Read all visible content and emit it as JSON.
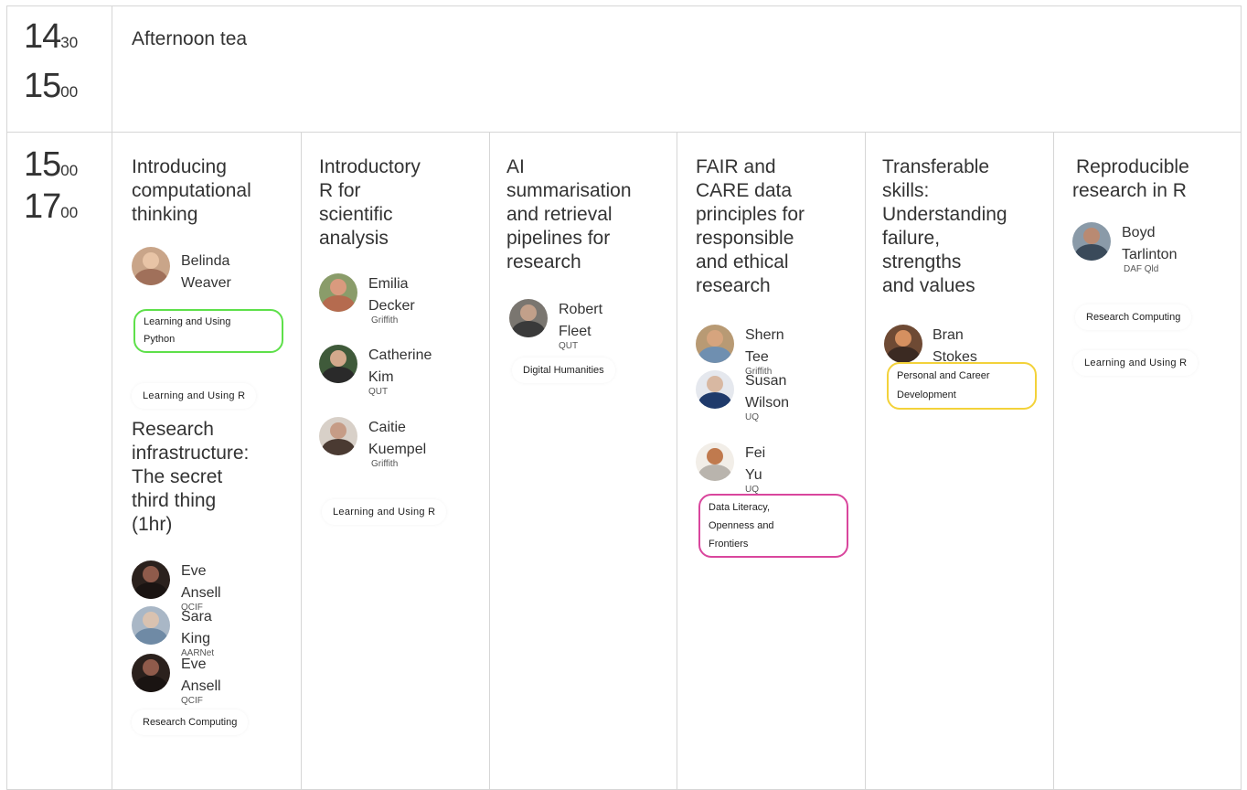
{
  "rows": [
    {
      "start": {
        "h": "14",
        "m": "30"
      },
      "end": {
        "h": "15",
        "m": "00"
      },
      "title": "Afternoon tea"
    },
    {
      "start": {
        "h": "15",
        "m": "00"
      },
      "end": {
        "h": "17",
        "m": "00"
      },
      "sessions": [
        {
          "title_lines": [
            "Introducing",
            "computational",
            "thinking"
          ],
          "speakers": [
            {
              "name_lines": [
                "Belinda",
                "Weaver"
              ],
              "org": ""
            }
          ],
          "tags": [
            {
              "lines": [
                "Learning and Using",
                "Python"
              ],
              "color": "#5ee04a"
            },
            {
              "lines": [
                "Learning and Using R"
              ],
              "color": ""
            }
          ],
          "second_title_lines": [
            "Research",
            "infrastructure:",
            "The secret",
            "third thing",
            "(1hr)"
          ],
          "second_speakers": [
            {
              "name_lines": [
                "Eve Ansell"
              ],
              "org": "QCIF"
            },
            {
              "name_lines": [
                "Sara King"
              ],
              "org": "AARNet"
            },
            {
              "name_lines": [
                "Eve Ansell"
              ],
              "org": "QCIF"
            }
          ],
          "second_tags": [
            {
              "lines": [
                "Research Computing"
              ],
              "color": ""
            }
          ]
        },
        {
          "title_lines": [
            "Introductory",
            "R for",
            "scientific",
            "analysis"
          ],
          "speakers": [
            {
              "name_lines": [
                "Emilia",
                "Decker"
              ],
              "org": "Griffith"
            },
            {
              "name_lines": [
                "Catherine",
                "Kim"
              ],
              "org": "QUT"
            },
            {
              "name_lines": [
                "Caitie",
                "Kuempel"
              ],
              "org": "Griffith"
            }
          ],
          "tags": [
            {
              "lines": [
                "Learning and Using R"
              ],
              "color": ""
            }
          ]
        },
        {
          "title_lines": [
            "AI",
            "summarisation",
            "and retrieval",
            "pipelines for",
            "research"
          ],
          "speakers": [
            {
              "name_lines": [
                "Robert Fleet"
              ],
              "org": "QUT"
            }
          ],
          "tags": [
            {
              "lines": [
                "Digital Humanities"
              ],
              "color": ""
            }
          ]
        },
        {
          "title_lines": [
            "FAIR and",
            "CARE data",
            "principles for",
            "responsible",
            "and ethical",
            "research"
          ],
          "speakers": [
            {
              "name_lines": [
                "Shern Tee"
              ],
              "org": "Griffith"
            },
            {
              "name_lines": [
                "Susan",
                "Wilson"
              ],
              "org": "UQ"
            },
            {
              "name_lines": [
                "Fei Yu"
              ],
              "org": "UQ"
            }
          ],
          "tags": [
            {
              "lines": [
                "Data Literacy,",
                "Openness and",
                "Frontiers"
              ],
              "color": "#d9469d"
            }
          ]
        },
        {
          "title_lines": [
            "Transferable",
            "skills:",
            "Understanding",
            "failure,",
            "strengths",
            "and values"
          ],
          "speakers": [
            {
              "name_lines": [
                "Bran Stokes"
              ],
              "org": ""
            }
          ],
          "tags": [
            {
              "lines": [
                "Personal and Career",
                "Development"
              ],
              "color": "#f3d23a"
            }
          ]
        },
        {
          "title_lines": [
            "Reproducible",
            "research in R"
          ],
          "speakers": [
            {
              "name_lines": [
                "Boyd",
                "Tarlinton"
              ],
              "org": "DAF Qld"
            }
          ],
          "tags": [
            {
              "lines": [
                "Research Computing"
              ],
              "color": ""
            },
            {
              "lines": [
                "Learning and Using R"
              ],
              "color": ""
            }
          ]
        }
      ]
    }
  ],
  "colors": {
    "border": "#d6d6d6",
    "text": "#333333",
    "python_tag": "#5ee04a",
    "data_literacy_tag": "#d9469d",
    "career_tag": "#f3d23a"
  },
  "icons": [
    "speaker-avatar"
  ]
}
